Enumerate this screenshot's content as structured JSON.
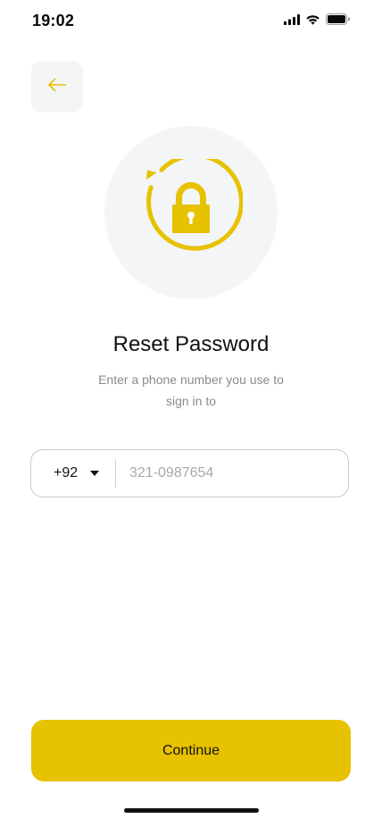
{
  "status_bar": {
    "time": "19:02"
  },
  "icons": {
    "back": "arrow-left-icon",
    "hero": "lock-reset-icon",
    "signal": "cellular-signal-icon",
    "wifi": "wifi-icon",
    "battery": "battery-icon",
    "dropdown": "chevron-down-icon"
  },
  "colors": {
    "accent": "#E6C200",
    "surface": "#F4F5F6",
    "subtitle": "#8A8A8A"
  },
  "reset": {
    "title": "Reset Password",
    "subtitle": "Enter a phone number you use to sign in to"
  },
  "phone": {
    "country_code": "+92",
    "placeholder": "321-0987654",
    "value": ""
  },
  "actions": {
    "continue_label": "Continue"
  }
}
